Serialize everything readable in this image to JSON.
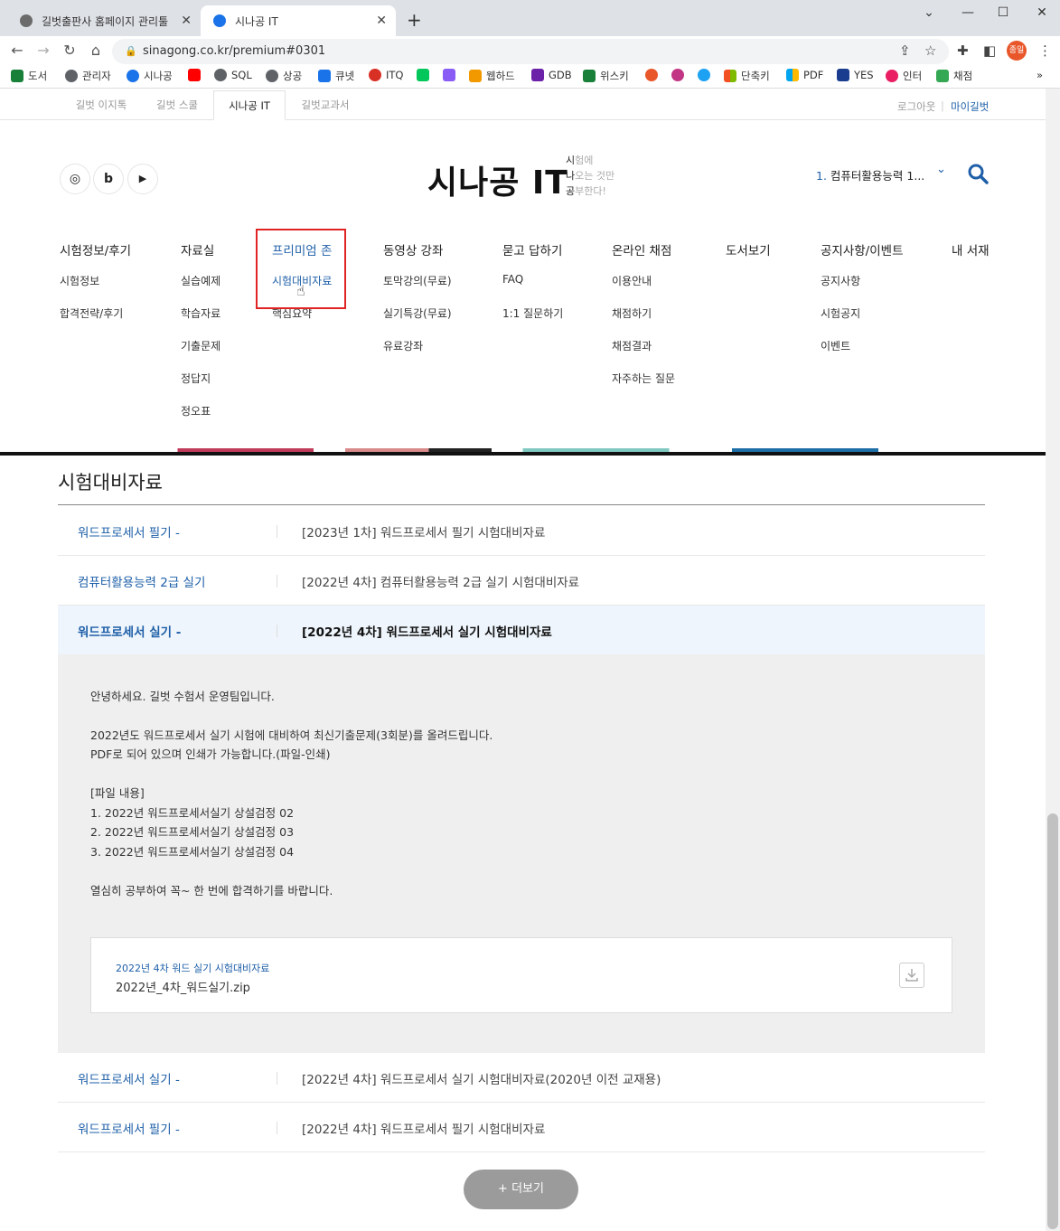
{
  "browser": {
    "tabs": [
      {
        "title": "길벗출판사 홈페이지 관리툴",
        "close": "✕"
      },
      {
        "title": "시나공 IT",
        "close": "✕"
      }
    ],
    "new_tab": "+",
    "window_controls": [
      "⌄",
      "—",
      "☐",
      "✕"
    ],
    "url": "sinagong.co.kr/premium#0301",
    "profile_label": "종일",
    "bookmarks": [
      {
        "label": "도서",
        "color": "#188038"
      },
      {
        "label": "관리자",
        "color": "#5f6368"
      },
      {
        "label": "시나공",
        "color": "#1a73e8"
      },
      {
        "label": "",
        "color": "#ff0000"
      },
      {
        "label": "SQL",
        "color": "#5f6368"
      },
      {
        "label": "상공",
        "color": "#5f6368"
      },
      {
        "label": "큐넷",
        "color": "#1a73e8"
      },
      {
        "label": "ITQ",
        "color": "#d93025"
      },
      {
        "label": "",
        "color": "#03c75a"
      },
      {
        "label": "",
        "color": "#8a5cf6"
      },
      {
        "label": "웹하드",
        "color": "#f29900"
      },
      {
        "label": "GDB",
        "color": "#6b21a8"
      },
      {
        "label": "위스키",
        "color": "#188038"
      },
      {
        "label": "",
        "color": "#e8562a"
      },
      {
        "label": "",
        "color": "#c13584"
      },
      {
        "label": "",
        "color": "#1da1f2"
      },
      {
        "label": "단축키",
        "color": "#f25022"
      },
      {
        "label": "PDF",
        "color": "#7fba00"
      },
      {
        "label": "YES",
        "color": "#1a3d8f"
      },
      {
        "label": "인터",
        "color": "#e91e63"
      },
      {
        "label": "채점",
        "color": "#34a853"
      }
    ],
    "bookmark_more": "»"
  },
  "site_tabs": [
    "길벗 이지톡",
    "길벗 스쿨",
    "시나공 IT",
    "길벗교과서"
  ],
  "top_links": {
    "logout": "로그아웃",
    "mypage": "마이길벗"
  },
  "sns": [
    "◎",
    "b",
    "▶"
  ],
  "logo": "시나공 IT",
  "slogan": [
    {
      "bold": "시",
      "rest": "험에"
    },
    {
      "bold": "나",
      "rest": "오는 것만"
    },
    {
      "bold": "공",
      "rest": "부한다!"
    }
  ],
  "selected_course": {
    "num": "1.",
    "name": "컴퓨터활용능력 1..."
  },
  "menu": [
    {
      "title": "시험정보/후기",
      "items": [
        "시험정보",
        "합격전략/후기"
      ]
    },
    {
      "title": "자료실",
      "items": [
        "실습예제",
        "학습자료",
        "기출문제",
        "정답지",
        "정오표"
      ]
    },
    {
      "title": "프리미엄 존",
      "items": [
        "시험대비자료",
        "핵심요약"
      ]
    },
    {
      "title": "동영상 강좌",
      "items": [
        "토막강의(무료)",
        "실기특강(무료)",
        "유료강좌"
      ]
    },
    {
      "title": "묻고 답하기",
      "items": [
        "FAQ",
        "1:1 질문하기"
      ]
    },
    {
      "title": "온라인 채점",
      "items": [
        "이용안내",
        "채점하기",
        "채점결과",
        "자주하는 질문"
      ]
    },
    {
      "title": "도서보기",
      "items": []
    },
    {
      "title": "공지사항/이벤트",
      "items": [
        "공지사항",
        "시험공지",
        "이벤트"
      ]
    },
    {
      "title": "내 서재",
      "items": []
    }
  ],
  "section_title": "시험대비자료",
  "rows": [
    {
      "category": "워드프로세서 필기 -",
      "title": "[2023년 1차] 워드프로세서 필기 시험대비자료"
    },
    {
      "category": "컴퓨터활용능력 2급 실기",
      "title": "[2022년 4차] 컴퓨터활용능력 2급 실기 시험대비자료"
    },
    {
      "category": "워드프로세서 실기 -",
      "title": "[2022년 4차] 워드프로세서 실기 시험대비자료"
    },
    {
      "category": "워드프로세서 실기 -",
      "title": "[2022년 4차] 워드프로세서 실기 시험대비자료(2020년 이전 교재용)"
    },
    {
      "category": "워드프로세서 필기 -",
      "title": "[2022년 4차] 워드프로세서 필기 시험대비자료"
    }
  ],
  "detail": {
    "lines": [
      "안녕하세요. 길벗 수험서 운영팀입니다.",
      "2022년도 워드프로세서 실기 시험에 대비하여 최신기출문제(3회분)를 올려드립니다.",
      "PDF로 되어 있으며 인쇄가 가능합니다.(파일-인쇄)",
      "[파일 내용]",
      "1. 2022년 워드프로세서실기 상설검정 02",
      "2. 2022년 워드프로세서실기 상설검정 03",
      "3. 2022년 워드프로세서실기 상설검정 04",
      "열심히 공부하여 꼭~ 한 번에 합격하기를 바랍니다."
    ],
    "file_label": "2022년 4차 워드 실기 시험대비자료",
    "file_name": "2022년_4차_워드실기.zip"
  },
  "more_button": "+ 더보기"
}
